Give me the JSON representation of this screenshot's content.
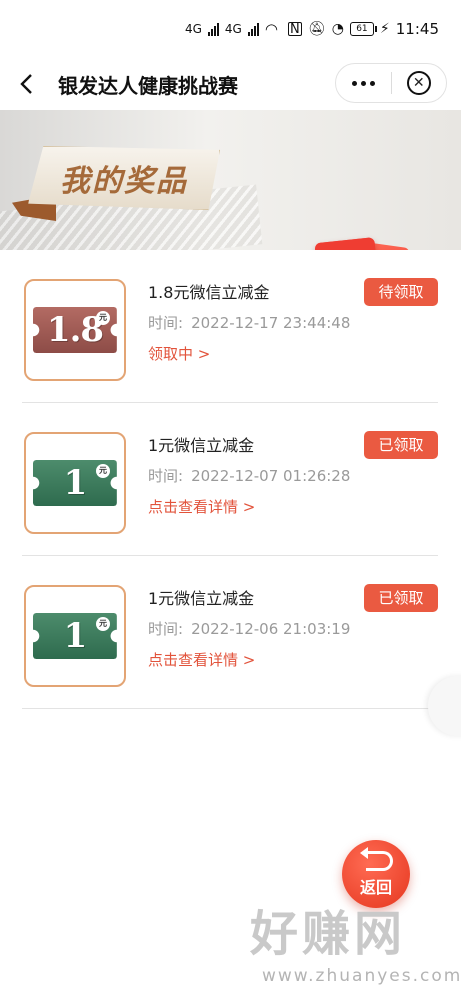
{
  "status_bar": {
    "net1": "4G",
    "net2": "4G",
    "battery": "61",
    "time": "11:45"
  },
  "nav": {
    "title": "银发达人健康挑战赛"
  },
  "banner": {
    "title": "我的奖品"
  },
  "colors": {
    "accent": "#ea5a41",
    "link": "#e2533b",
    "coupon_border": "#e3a474",
    "ticket_brown": "#9c5a52",
    "ticket_green": "#3a7a5b"
  },
  "prizes": [
    {
      "coupon_amount": "1.8",
      "coupon_unit": "元",
      "name": "1.8元微信立减金",
      "time_label": "时间:",
      "time": "2022-12-17 23:44:48",
      "link": "领取中 >",
      "status": "待领取"
    },
    {
      "coupon_amount": "1",
      "coupon_unit": "元",
      "name": "1元微信立减金",
      "time_label": "时间:",
      "time": "2022-12-07 01:26:28",
      "link": "点击查看详情 >",
      "status": "已领取"
    },
    {
      "coupon_amount": "1",
      "coupon_unit": "元",
      "name": "1元微信立减金",
      "time_label": "时间:",
      "time": "2022-12-06 21:03:19",
      "link": "点击查看详情 >",
      "status": "已领取"
    }
  ],
  "return_button": {
    "label": "返回"
  },
  "watermark": {
    "main": "好赚网",
    "url": "www.zhuanyes.com"
  }
}
